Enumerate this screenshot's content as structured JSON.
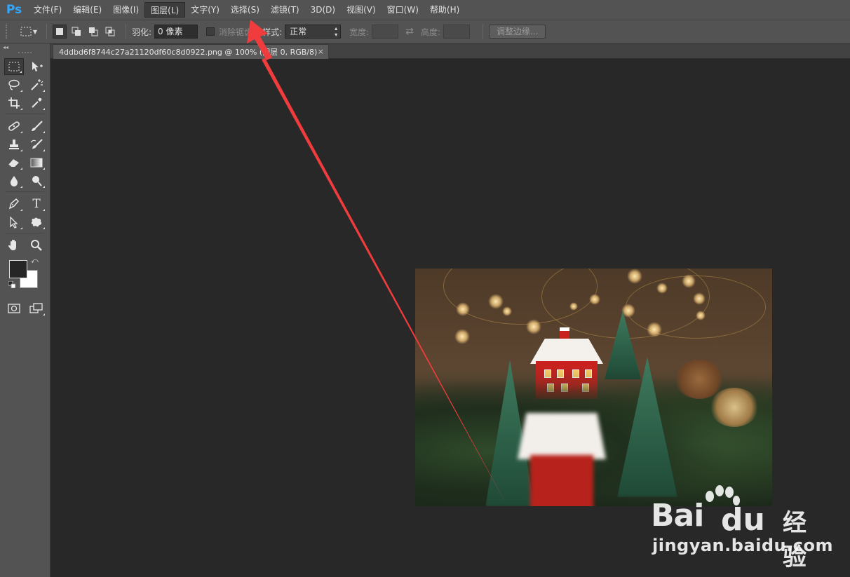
{
  "app": {
    "logo": "Ps"
  },
  "menu": [
    {
      "label": "文件(F)",
      "active": false
    },
    {
      "label": "编辑(E)",
      "active": false
    },
    {
      "label": "图像(I)",
      "active": false
    },
    {
      "label": "图层(L)",
      "active": true
    },
    {
      "label": "文字(Y)",
      "active": false
    },
    {
      "label": "选择(S)",
      "active": false
    },
    {
      "label": "滤镜(T)",
      "active": false
    },
    {
      "label": "3D(D)",
      "active": false
    },
    {
      "label": "视图(V)",
      "active": false
    },
    {
      "label": "窗口(W)",
      "active": false
    },
    {
      "label": "帮助(H)",
      "active": false
    }
  ],
  "options": {
    "feather_label": "羽化:",
    "feather_value": "0 像素",
    "antialias_label": "消除锯齿",
    "style_label": "样式:",
    "style_value": "正常",
    "width_label": "宽度:",
    "height_label": "高度:",
    "refine_edge_label": "调整边缘..."
  },
  "document": {
    "tab_title": "4ddbd6f8744c27a21120df60c8d0922.png @ 100% (图层 0, RGB/8)",
    "close_glyph": "×"
  },
  "toolbox": {
    "collapse_glyph": "◂◂",
    "tools": [
      [
        "rectangular-marquee-icon",
        "move-icon"
      ],
      [
        "lasso-icon",
        "magic-wand-icon"
      ],
      [
        "crop-icon",
        "eyedropper-icon"
      ],
      [
        "healing-brush-icon",
        "brush-icon"
      ],
      [
        "clone-stamp-icon",
        "history-brush-icon"
      ],
      [
        "eraser-icon",
        "gradient-icon"
      ],
      [
        "blur-icon",
        "dodge-icon"
      ],
      [
        "pen-icon",
        "type-icon"
      ],
      [
        "path-selection-icon",
        "custom-shape-icon"
      ],
      [
        "hand-icon",
        "zoom-icon"
      ]
    ],
    "type_glyph": "T",
    "foreground_color": "#262626",
    "background_color": "#ffffff"
  },
  "colors": {
    "menubar": "#535353",
    "workspace": "#282828",
    "annotation_arrow": "#f03c3c",
    "ps_logo": "#31a8ff"
  },
  "watermark": {
    "brand": "Bai",
    "brand_tail": "经验",
    "url": "jingyan.baidu.com"
  }
}
